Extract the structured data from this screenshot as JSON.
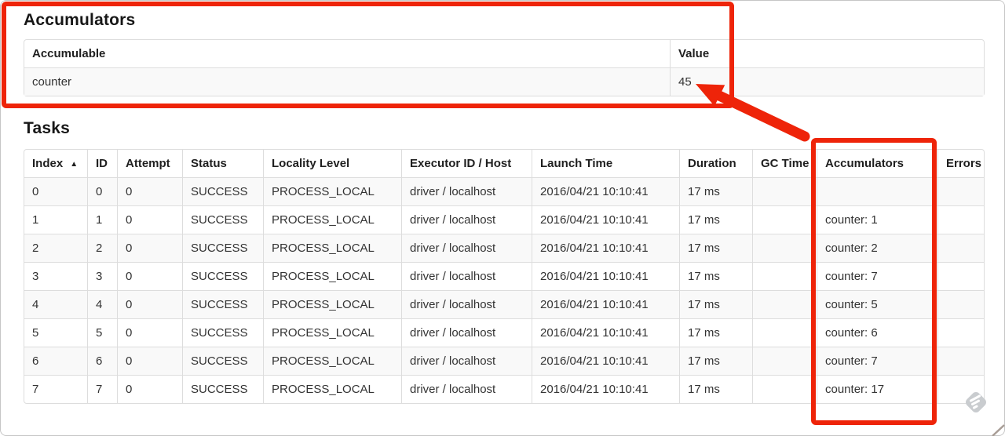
{
  "accumulators_section": {
    "heading": "Accumulators",
    "table": {
      "headers": {
        "accumulable": "Accumulable",
        "value": "Value"
      },
      "rows": [
        {
          "accumulable": "counter",
          "value": "45"
        }
      ]
    }
  },
  "tasks_section": {
    "heading": "Tasks",
    "table": {
      "headers": {
        "index": "Index",
        "sort_indicator": "▲",
        "id": "ID",
        "attempt": "Attempt",
        "status": "Status",
        "locality": "Locality Level",
        "executor": "Executor ID / Host",
        "launch_time": "Launch Time",
        "duration": "Duration",
        "gc_time": "GC Time",
        "accumulators": "Accumulators",
        "errors": "Errors"
      },
      "rows": [
        {
          "index": "0",
          "id": "0",
          "attempt": "0",
          "status": "SUCCESS",
          "locality": "PROCESS_LOCAL",
          "executor": "driver / localhost",
          "launch_time": "2016/04/21 10:10:41",
          "duration": "17 ms",
          "gc_time": "",
          "accumulators": "",
          "errors": ""
        },
        {
          "index": "1",
          "id": "1",
          "attempt": "0",
          "status": "SUCCESS",
          "locality": "PROCESS_LOCAL",
          "executor": "driver / localhost",
          "launch_time": "2016/04/21 10:10:41",
          "duration": "17 ms",
          "gc_time": "",
          "accumulators": "counter: 1",
          "errors": ""
        },
        {
          "index": "2",
          "id": "2",
          "attempt": "0",
          "status": "SUCCESS",
          "locality": "PROCESS_LOCAL",
          "executor": "driver / localhost",
          "launch_time": "2016/04/21 10:10:41",
          "duration": "17 ms",
          "gc_time": "",
          "accumulators": "counter: 2",
          "errors": ""
        },
        {
          "index": "3",
          "id": "3",
          "attempt": "0",
          "status": "SUCCESS",
          "locality": "PROCESS_LOCAL",
          "executor": "driver / localhost",
          "launch_time": "2016/04/21 10:10:41",
          "duration": "17 ms",
          "gc_time": "",
          "accumulators": "counter: 7",
          "errors": ""
        },
        {
          "index": "4",
          "id": "4",
          "attempt": "0",
          "status": "SUCCESS",
          "locality": "PROCESS_LOCAL",
          "executor": "driver / localhost",
          "launch_time": "2016/04/21 10:10:41",
          "duration": "17 ms",
          "gc_time": "",
          "accumulators": "counter: 5",
          "errors": ""
        },
        {
          "index": "5",
          "id": "5",
          "attempt": "0",
          "status": "SUCCESS",
          "locality": "PROCESS_LOCAL",
          "executor": "driver / localhost",
          "launch_time": "2016/04/21 10:10:41",
          "duration": "17 ms",
          "gc_time": "",
          "accumulators": "counter: 6",
          "errors": ""
        },
        {
          "index": "6",
          "id": "6",
          "attempt": "0",
          "status": "SUCCESS",
          "locality": "PROCESS_LOCAL",
          "executor": "driver / localhost",
          "launch_time": "2016/04/21 10:10:41",
          "duration": "17 ms",
          "gc_time": "",
          "accumulators": "counter: 7",
          "errors": ""
        },
        {
          "index": "7",
          "id": "7",
          "attempt": "0",
          "status": "SUCCESS",
          "locality": "PROCESS_LOCAL",
          "executor": "driver / localhost",
          "launch_time": "2016/04/21 10:10:41",
          "duration": "17 ms",
          "gc_time": "",
          "accumulators": "counter: 17",
          "errors": ""
        }
      ]
    }
  },
  "annotations": {
    "highlight_color": "#ee2409",
    "boxed_regions": [
      "accumulators-summary-table",
      "tasks-accumulators-column"
    ],
    "arrow_points_to": "45"
  },
  "watermark": {
    "color": "#c9cccf"
  }
}
